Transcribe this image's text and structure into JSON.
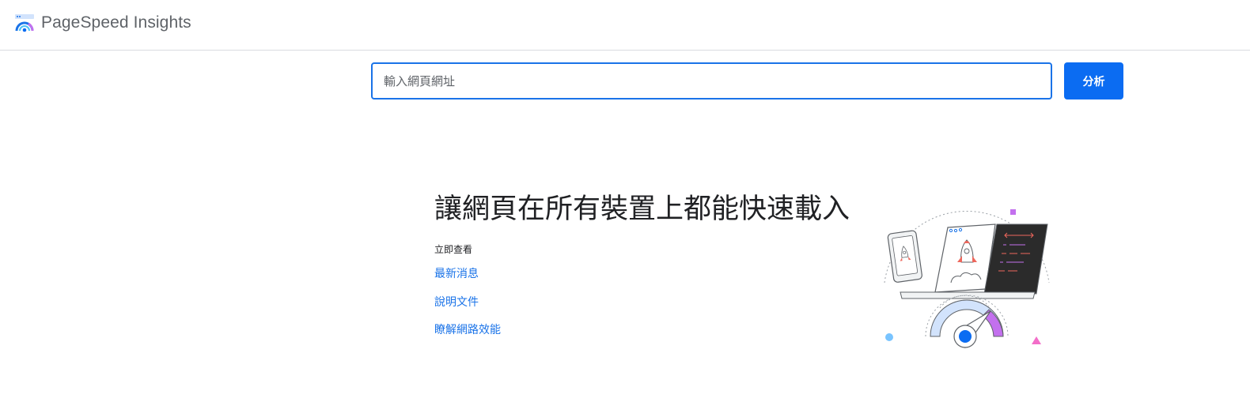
{
  "header": {
    "brand_name": "PageSpeed Insights",
    "logo_icon": "pagespeed-gauge-icon"
  },
  "search": {
    "placeholder": "輸入網頁網址",
    "value": "",
    "button_label": "分析"
  },
  "hero": {
    "title": "讓網頁在所有裝置上都能快速載入",
    "check_label": "立即查看",
    "links": [
      {
        "label": "最新消息"
      },
      {
        "label": "說明文件"
      },
      {
        "label": "瞭解網路效能"
      }
    ],
    "illustration": "rocket-speed-gauge-illustration"
  },
  "colors": {
    "accent": "#1a73e8",
    "button": "#0b6cf2",
    "gauge_accent": "#c370ee",
    "code_bg": "#2b2b2b"
  }
}
